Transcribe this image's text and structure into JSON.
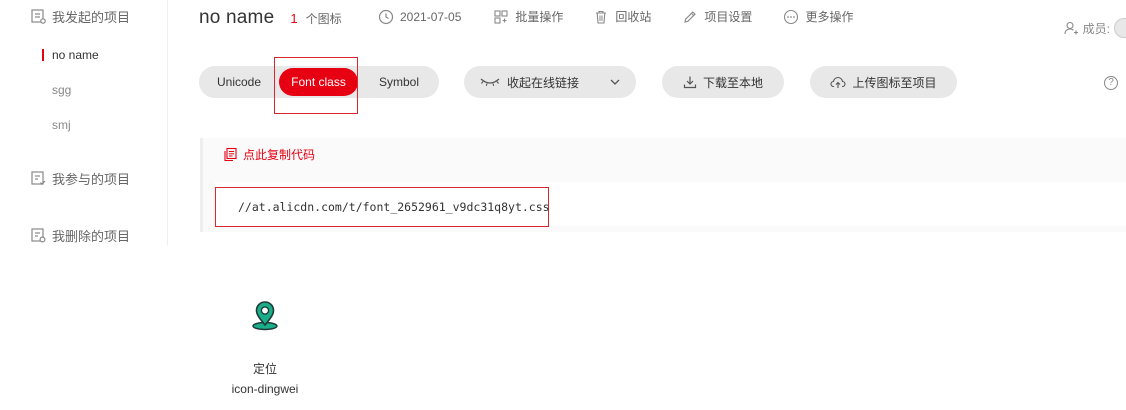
{
  "sidebar": {
    "my_projects": "我发起的项目",
    "projects": [
      {
        "label": "no name",
        "active": true
      },
      {
        "label": "sgg",
        "active": false
      },
      {
        "label": "smj",
        "active": false
      }
    ],
    "joined_projects": "我参与的项目",
    "deleted_projects": "我删除的项目"
  },
  "header": {
    "title": "no name",
    "icon_count": "1",
    "icon_count_label": "个图标",
    "date": "2021-07-05",
    "batch": "批量操作",
    "recycle": "回收站",
    "settings": "项目设置",
    "more": "更多操作",
    "members": "成员:"
  },
  "tabs": {
    "unicode": "Unicode",
    "font_class": "Font class",
    "symbol": "Symbol"
  },
  "actions": {
    "collapse_link": "收起在线链接",
    "download": "下载至本地",
    "upload": "上传图标至项目",
    "help": "?"
  },
  "code": {
    "copy_label": "点此复制代码",
    "url": "//at.alicdn.com/t/font_2652961_v9dc31q8yt.css"
  },
  "icons": [
    {
      "name": "定位",
      "code": "icon-dingwei",
      "icon": "location-pin-icon",
      "color": "#1aad8a"
    }
  ],
  "colors": {
    "accent": "#e60012",
    "highlight_border": "#d9272e"
  }
}
